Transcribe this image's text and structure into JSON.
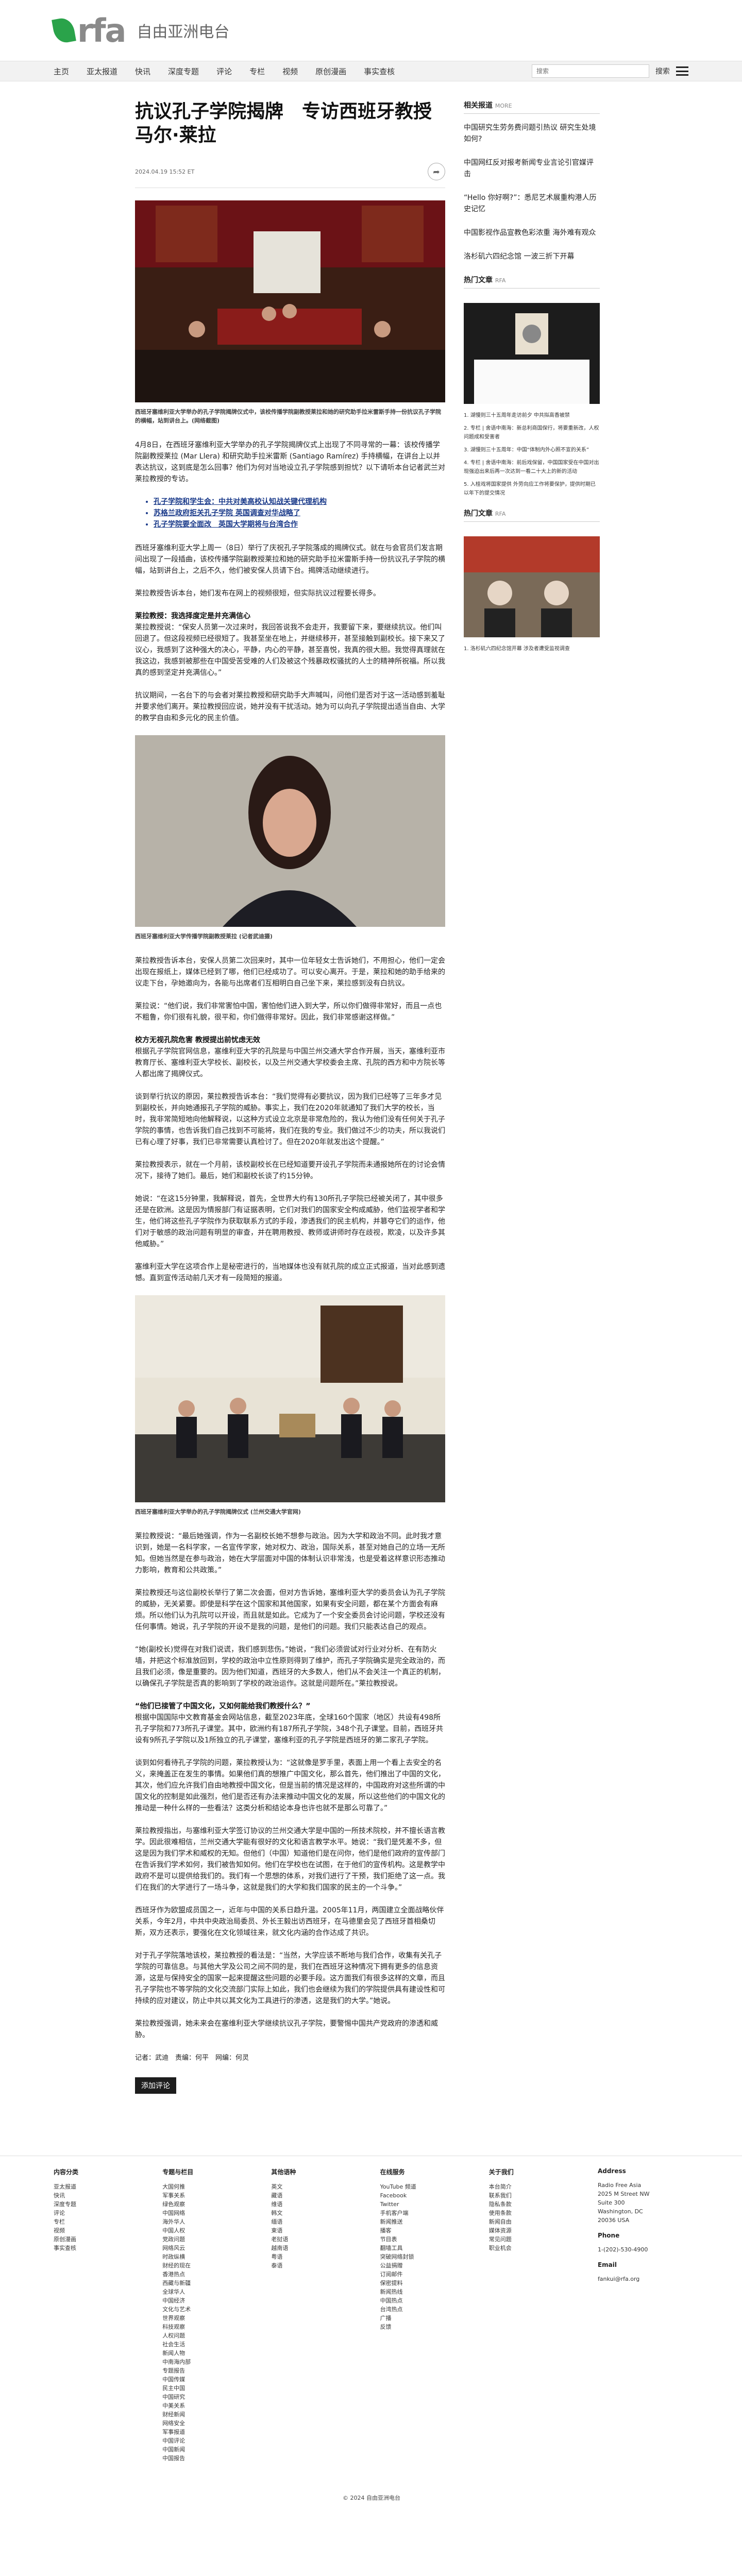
{
  "brand": {
    "logo": "rfa",
    "name": "自由亚洲电台"
  },
  "nav": [
    "主页",
    "亚太报道",
    "快讯",
    "深度专题",
    "评论",
    "专栏",
    "视频",
    "原创漫画",
    "事实查核"
  ],
  "search": {
    "placeholder": "搜索",
    "button": "搜索"
  },
  "article": {
    "title": "抗议孔子学院揭牌　专访西班牙教授马尔·莱拉",
    "date": "2024.04.19 15:52 ET",
    "photo1_caption": "西班牙塞维利亚大学举办的孔子学院揭牌仪式中，该校传播学院副教授莱拉和她的研究助手拉米雷斯手持一份抗议孔子学院的横幅，站到讲台上。(网络截图)",
    "p1": "4月8日，在西班牙塞维利亚大学举办的孔子学院揭牌仪式上出现了不同寻常的一幕：该校传播学院副教授莱拉 (Mar Llera) 和研究助手拉米雷斯 (Santiago Ramírez) 手持横幅，在讲台上以并表达抗议，这到底是怎么回事？他们为何对当地设立孔子学院感到担忧？以下请听本台记者武兰对莱拉教授的专访。",
    "links": [
      "孔子学院和学生会：中共对美高校认知战关键代理机构",
      "苏格兰政府拒关孔子学院 英国调查对华战略了",
      "孔子学院要全面改　英国大学期将与台湾合作"
    ],
    "p2": "西班牙塞维利亚大学上周一（8日）举行了庆祝孔子学院落成的揭牌仪式。就在与会官员们发言期间出现了一段插曲，该校传播学院副教授莱拉和她的研究助手拉米雷斯手持一份抗议孔子学院的横幅，站到讲台上，之后不久，他们被安保人员请下台。揭牌活动继续进行。",
    "p3": "莱拉教授告诉本台，她们发布在网上的视频很短，但实际抗议过程要长得多。",
    "h1": "莱拉教授：我选择度定是并充满信心",
    "p4": "莱拉教授说：“保安人员第一次过来时，我回答说我不会走开，我要留下来，要继续抗议。他们叫回退了。但这段视频已经很短了。我甚至坐在地上，并继续移开，甚至接触到副校长。接下来又了议心，我感到了这种强大的决心，平静，内心的平静，甚至喜悦，我真的很大胆。我觉得真理就在我这边，我感到被那些在中国受苦受难的人们及被这个残暴政权骚扰的人士的精神所祝福。所以我真的感到坚定并充满信心。”",
    "p5": "抗议期间，一名台下的与会者对莱拉教授和研究助手大声喊叫，问他们是否对于这一活动感到羞耻并要求他们离开。莱拉教授回应说，她并没有干扰活动。她为可以向孔子学院提出适当自由、大学的教学自由和多元化的民主价值。",
    "photo2_caption": "西班牙塞维利亚大学传播学院副教授莱拉 (记者武迪摄)",
    "p6": "莱拉教授告诉本台，安保人员第二次回来时，其中一位年轻女士告诉她们，不用担心，他们一定会出现在报纸上，媒体已经到了哪，他们已经成功了。可以安心离开。于是，莱拉和她的助手给来的议走下台，孕她邀向为，各能与出席者们互相明白自己坐下来，莱拉感到没有白抗议。",
    "p7": "莱拉说：“他们说，我们非常害怕中国，害怕他们进入到大学，所以你们做得非常好，而且一点也不粗鲁，你们很有礼貌，很平和，你们做得非常好。因此，我们非常感谢这样做。”",
    "h2": "校方无视孔院危害 教授提出前忧虑无效",
    "p8": "根据孔子学院官网信息，塞维利亚大学的孔院是与中国兰州交通大学合作开展，当天，塞维利亚市教育厅长、塞维利亚大学校长、副校长，以及兰州交通大学校委会主席、孔院的西方和中方院长等人都出席了揭牌仪式。",
    "p9": "谈到举行抗议的原因，莱拉教授告诉本台：“我们觉得有必要抗议，因为我们已经等了三年多才见到副校长，并向她通报孔子学院的威胁。事实上，我们在2020年就通知了我们大学的校长，当时，我非常简短地向他解释说，以这种方式设立北京是非常危险的，我认为他们没有任何关于孔子学院的事情，也告诉我们自己找到不可能将，我们在我的专业。我们做过不少的功夫，所以我说们已有心理了好事，我们已非常需要认真检讨了。但在2020年就发出这个提醒。”",
    "p10": "莱拉教授表示，就在一个月前，该校副校长在已经知道要开设孔子学院而未通报她所在的讨论会情况下，接待了她们。最后，她们和副校长谈了约15分钟。",
    "p11": "她说：“在这15分钟里，我解释说，首先，全世界大约有130所孔子学院已经被关闭了，其中很多还是在欧洲。这是因为情报部门有证据表明，它们对我们的国家安全构成威胁，他们监视学者和学生，他们将这些孔子学院作为获取联系方式的手段，渗透我们的民主机构，并篡夺它们的运作，他们对于敏感的政治问题有明显的审查，并在聘用教授、教师或讲师时存在歧视，欺凌，以及许多其他威胁。”",
    "p12": "塞维利亚大学在这项合作上是秘密进行的，当地媒体也没有就孔院的成立正式报道，当对此感到遗憾。直到宣传活动前几天才有一段简短的报道。",
    "photo3_caption": "西班牙塞维利亚大学举办的孔子学院揭牌仪式 (兰州交通大学官网)",
    "p13": "莱拉教授说：“最后她强调，作为一名副校长她不想参与政治。因为大学和政治不同。此时我才意识到，她是一名科学家，一名宣传学家，她对权力、政治，国际关系，甚至对她自己的立场一无所知。但她当然是在参与政治，她在大学层面对中国的体制认识非常浅，也是受着这样意识形态推动力影响，教育和公共政策。”",
    "p14": "莱拉教授还与这位副校长举行了第二次会面，但对方告诉她，塞维利亚大学的委员会认为孔子学院的威胁，无关紧要。即使是科学在这个国家和其他国家，如果有安全问题，都在某个方面会有麻烦。所以他们认为孔院可以开设，而且就是如此。它成为了一个安全委员会讨论问题，学校还没有任何事情。她说，孔子学院的开设不是我的问题，是他们的问题。我们只能表达自己的观点。",
    "p15": "“她(副校长)觉得在对我们说谎，我们感到悲伤。”她说，“我们必须尝试对行业对分析、在有防火墙，并把这个标准放回到，学校的政治中立性原则得到了维护，而孔子学院确实是完全政治的，而且我们必须，像是重要的。因为他们知道，西班牙的大多数人，他们从不会关注一个真正的机制，以确保孔子学院是否真的影响到了学校的政治运作。这就是问题所在。”莱拉教授说。",
    "h3": "“他们已接管了中国文化，又如何能给我们教授什么？”",
    "p16": "根据中国国际中文教育基金会网站信息，截至2023年底，全球160个国家（地区）共设有498所孔子学院和773所孔子课堂。其中，欧洲约有187所孔子学院，348个孔子课堂。目前，西班牙共设有9所孔子学院以及1所独立的孔子课堂，塞维利亚的孔子学院是西班牙的第二家孔子学院。",
    "p17": "谈到如何看待孔子学院的问题，莱拉教授认为：“这就像是罗手里，表面上用一个看上去安全的名义，来掩盖正在发生的事情。如果他们真的想推广中国文化，那么首先，他们推出了中国的文化，其次，他们应允许我们自由地教授中国文化，但是当前的情况是这样的，中国政府对这些所谓的中国文化的控制是如此强烈，他们是否还有办法来推动中国文化的发展，所以这些他们的中国文化的推动是一种什么样的一些看法？这类分析和结论本身也许也就不是那么可靠了。”",
    "p18": "莱拉教授指出，与塞维利亚大学签订协议的兰州交通大学是中国的一所技术院校，并不擅长语言教学。因此很难相信，兰州交通大学能有很好的文化和语言教学水平。她说：“我们是凭差不多，但这是因为我们学术和威权的无知。但他们（中国）知道他们是在问你，他们是他们政府的宣传部门在告诉我们学术如何，我们被告知如何。他们在学校也在试图，在于他们的宣传机构。这是教学中政府不是可以提供给我们的。我们有一个思想的体系，对我们进行了干预，我们拒绝了这一点。我们在我们的大学进行了一场斗争，这就是我们的大学和我们国家的民主的一个斗争。”",
    "p19": "西班牙作为欧盟成员国之一，近年与中国的关系日趋升温。2005年11月，两国建立全面战略伙伴关系，今年2月，中共中央政治局委员、外长王毅出访西班牙，在马德里会见了西班牙首相桑切斯，双方还表示，要强化在文化领域往来，就文化内涵的合作达成了共识。",
    "p20": "对于孔子学院落地该校，莱拉教授的看法是：“当然，大学应该不断地与我们合作，收集有关孔子学院的可靠信息。与其他大学及公司之间不同的是，我们在西班牙这种情况下拥有更多的信息资源，这是与保持安全的国家一起来提醒这些问题的必要手段。这方面我们有很多这样的文章，而且孔子学院也不等学院的文化交流部门实际上如此，我们也会继续为我们的学院提供具有建设性和可持续的应对建议，防止中共以其文化为工具进行的渗透，这是我们的大学。”她说。",
    "p21": "莱拉教授强调，她未来会在塞维利亚大学继续抗议孔子学院，要警惕中国共产党政府的渗透和威胁。",
    "byline": "记者：武迪　责编：何平　网编：何灵",
    "comment_btn": "添加评论"
  },
  "sidebar": {
    "related_head": "相关报道",
    "related_small": "MORE",
    "related": [
      "中国研究生劳务费问题引热议 研究生处境如何?",
      "中国网红反对报考新闻专业言论引官媒评击",
      "“Hello 你好啊?”：悉尼艺术展重构港人历史记忆",
      "中国影视作品宣教色彩浓重 海外难有观众",
      "洛杉矶六四纪念馆 一波三折下开幕"
    ],
    "hot_head": "热门文章",
    "hot_small": "RFA",
    "hot_items": [
      "1. 湖慢则三十五周年走访前夕 中共拟高香被禁",
      "2. 专栏 | 舍语中南海：新总利商国保行，将要重新改，人权问题成和受害者",
      "3. 湖慢则三十五周年：中国“体制内外心照不宣的关系”",
      "4. 专栏 | 舍语中南海：前后戏保留，中国国家受在中国对出现强迫出来后再一次达到一看二十大上的新的活动",
      "5. 入桂戏将国家提供 外劳向应工作将要保护，提供时期已以年下的提交情况"
    ],
    "hot_head2": "热门文章",
    "hot_small2": "RFA",
    "hot_items2": [
      "1. 洛杉矶六四纪念馆开幕 涉及者遭受监视调查"
    ]
  },
  "footer": {
    "col1_title": "内容分类",
    "col1": [
      "亚太报道",
      "快讯",
      "深度专题",
      "评论",
      "专栏",
      "视频",
      "原创漫画",
      "事实查核"
    ],
    "col2_title": "专题与栏目",
    "col2": [
      "大国何推",
      "军事关系",
      "绿色观察",
      "中国网络",
      "海外华人",
      "中国人权",
      "党政问题",
      "网络风云",
      "时政纵横",
      "财经的现在",
      "香港热点",
      "西藏与新疆",
      "全球华人",
      "中国经济",
      "文化与艺术",
      "世界观察",
      "科技观察",
      "人权问题",
      "社会生活",
      "新闻人物",
      "中南海内部",
      "专题报告",
      "中国传媒",
      "民主中国",
      "中国研究",
      "中美关系",
      "财经新闻",
      "网络安全",
      "军事报道",
      "中国评论",
      "中国新闻",
      "中国报告"
    ],
    "col3_title": "其他语种",
    "col3": [
      "英文",
      "藏语",
      "维语",
      "韩文",
      "缅语",
      "柬语",
      "老挝语",
      "越南语",
      "粤语",
      "泰语"
    ],
    "col4_title": "在线服务",
    "col4": [
      "YouTube 频道",
      "Facebook",
      "Twitter",
      "手机客户端",
      "新闻推送",
      "播客",
      "节目表",
      "翻墙工具",
      "突破网络封锁",
      "公益捐赠",
      "订阅邮件",
      "保密提料",
      "新闻热线",
      "中国热点",
      "台湾热点",
      "广播",
      "反馈"
    ],
    "col5_title": "关于我们",
    "col5": [
      "本台简介",
      "联系我们",
      "隐私条款",
      "使用条款",
      "新闻自由",
      "媒体资源",
      "常见问题",
      "职业机会"
    ],
    "addr_title": "Address",
    "addr": [
      "Radio Free Asia",
      "2025 M Street NW",
      "Suite 300",
      "Washington, DC",
      "20036 USA"
    ],
    "phone_title": "Phone",
    "phone": "1-(202)-530-4900",
    "email_title": "Email",
    "email": "fankui@rfa.org",
    "copyright": "© 2024 自由亚洲电台"
  }
}
